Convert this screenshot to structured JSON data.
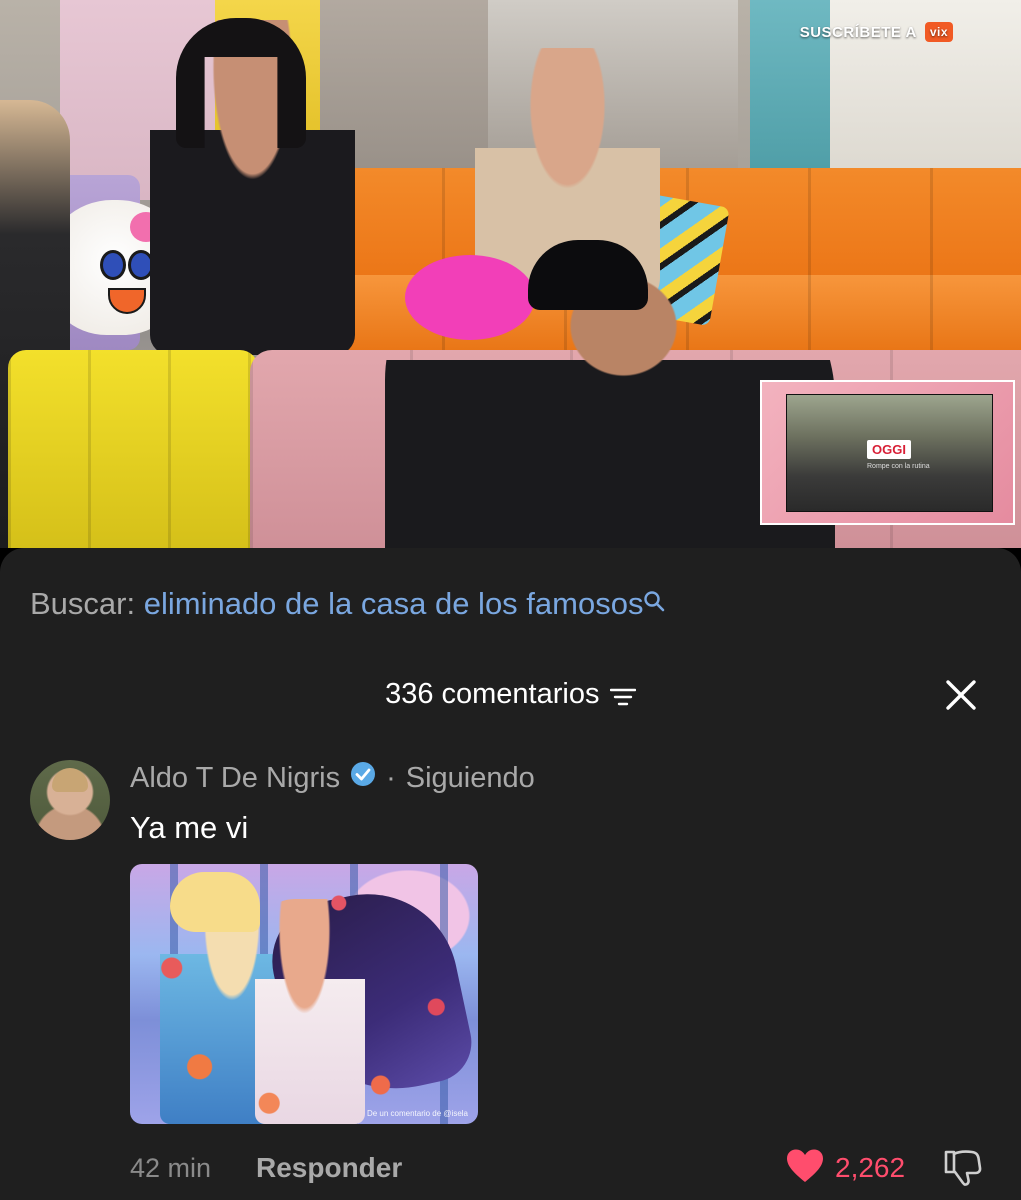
{
  "video": {
    "subscribe_text": "SUSCRÍBETE A",
    "brand_logo_text": "vix",
    "pip_logo_text": "OGGI",
    "pip_tagline": "Rompe con la rutina"
  },
  "search": {
    "label": "Buscar:",
    "query": "eliminado de la casa de los famosos"
  },
  "comments_header": {
    "count_label": "336 comentarios"
  },
  "comment": {
    "author": "Aldo T De Nigris",
    "separator": "·",
    "follow_status": "Siguiendo",
    "text": "Ya me vi",
    "image_caption": "De un comentario de @isela",
    "timestamp": "42 min",
    "reply_label": "Responder",
    "like_count": "2,262"
  },
  "colors": {
    "sheet_background": "#1f1f1f",
    "search_query": "#7aa7e0",
    "like_accent": "#ff4d6d",
    "verified_badge": "#5aa9e6"
  },
  "icons": {
    "search": "search-icon",
    "filter": "filter-icon",
    "close": "close-icon",
    "verified": "verified-icon",
    "like": "heart-icon",
    "dislike": "dislike-icon"
  }
}
